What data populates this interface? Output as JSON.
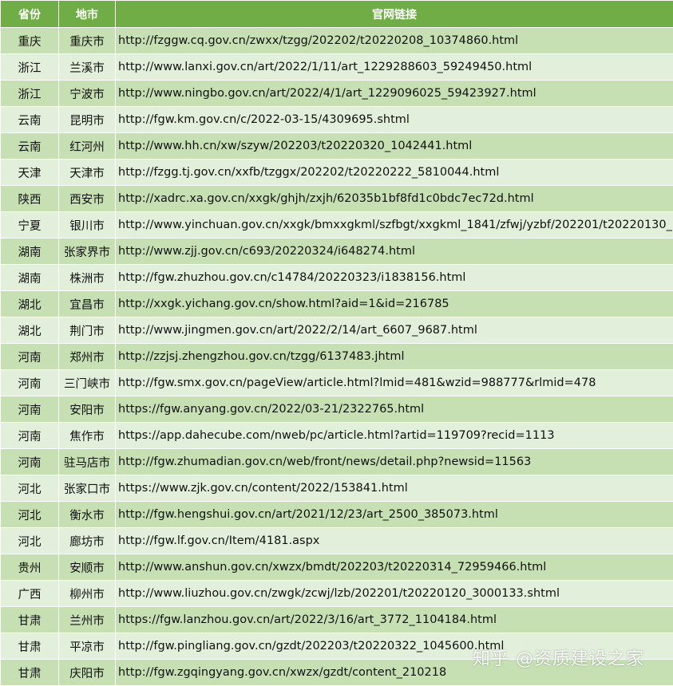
{
  "table": {
    "headers": {
      "province": "省份",
      "city": "地市",
      "link": "官网链接"
    },
    "rows": [
      {
        "province": "重庆",
        "city": "重庆市",
        "url": "http://fzggw.cq.gov.cn/zwxx/tzgg/202202/t20220208_10374860.html"
      },
      {
        "province": "浙江",
        "city": "兰溪市",
        "url": "http://www.lanxi.gov.cn/art/2022/1/11/art_1229288603_59249450.html"
      },
      {
        "province": "浙江",
        "city": "宁波市",
        "url": "http://www.ningbo.gov.cn/art/2022/4/1/art_1229096025_59423927.html"
      },
      {
        "province": "云南",
        "city": "昆明市",
        "url": "http://fgw.km.gov.cn/c/2022-03-15/4309695.shtml"
      },
      {
        "province": "云南",
        "city": "红河州",
        "url": "http://www.hh.cn/xw/szyw/202203/t20220320_1042441.html"
      },
      {
        "province": "天津",
        "city": "天津市",
        "url": "http://fzgg.tj.gov.cn/xxfb/tzggx/202202/t20220222_5810044.html"
      },
      {
        "province": "陕西",
        "city": "西安市",
        "url": "http://xadrc.xa.gov.cn/xxgk/ghjh/zxjh/62035b1bf8fd1c0bdc7ec72d.html"
      },
      {
        "province": "宁夏",
        "city": "银川市",
        "url": "http://www.yinchuan.gov.cn/xxgk/bmxxgkml/szfbgt/xxgkml_1841/zfwj/yzbf/202201/t20220130_"
      },
      {
        "province": "湖南",
        "city": "张家界市",
        "url": "http://www.zjj.gov.cn/c693/20220324/i648274.html"
      },
      {
        "province": "湖南",
        "city": "株洲市",
        "url": "http://fgw.zhuzhou.gov.cn/c14784/20220323/i1838156.html"
      },
      {
        "province": "湖北",
        "city": "宜昌市",
        "url": "http://xxgk.yichang.gov.cn/show.html?aid=1&id=216785"
      },
      {
        "province": "湖北",
        "city": "荆门市",
        "url": "http://www.jingmen.gov.cn/art/2022/2/14/art_6607_9687.html"
      },
      {
        "province": "河南",
        "city": "郑州市",
        "url": "http://zzjsj.zhengzhou.gov.cn/tzgg/6137483.jhtml"
      },
      {
        "province": "河南",
        "city": "三门峡市",
        "url": "http://fgw.smx.gov.cn/pageView/article.html?lmid=481&wzid=988777&rlmid=478"
      },
      {
        "province": "河南",
        "city": "安阳市",
        "url": "https://fgw.anyang.gov.cn/2022/03-21/2322765.html"
      },
      {
        "province": "河南",
        "city": "焦作市",
        "url": "https://app.dahecube.com/nweb/pc/article.html?artid=119709?recid=1113"
      },
      {
        "province": "河南",
        "city": "驻马店市",
        "url": "http://fgw.zhumadian.gov.cn/web/front/news/detail.php?newsid=11563"
      },
      {
        "province": "河北",
        "city": "张家口市",
        "url": "https://www.zjk.gov.cn/content/2022/153841.html"
      },
      {
        "province": "河北",
        "city": "衡水市",
        "url": "http://fgw.hengshui.gov.cn/art/2021/12/23/art_2500_385073.html"
      },
      {
        "province": "河北",
        "city": "廊坊市",
        "url": "http://fgw.lf.gov.cn/Item/4181.aspx"
      },
      {
        "province": "贵州",
        "city": "安顺市",
        "url": "http://www.anshun.gov.cn/xwzx/bmdt/202203/t20220314_72959466.html"
      },
      {
        "province": "广西",
        "city": "柳州市",
        "url": "http://www.liuzhou.gov.cn/zwgk/zcwj/lzb/202201/t20220120_3000133.shtml"
      },
      {
        "province": "甘肃",
        "city": "兰州市",
        "url": "https://fgw.lanzhou.gov.cn/art/2022/3/16/art_3772_1104184.html"
      },
      {
        "province": "甘肃",
        "city": "平凉市",
        "url": "http://fgw.pingliang.gov.cn/gzdt/202203/t20220322_1045600.html"
      },
      {
        "province": "甘肃",
        "city": "庆阳市",
        "url": "http://fgw.zgqingyang.gov.cn/xwzx/gzdt/content_210218"
      }
    ]
  },
  "watermark": {
    "text": "知乎 @资质建设之家"
  }
}
